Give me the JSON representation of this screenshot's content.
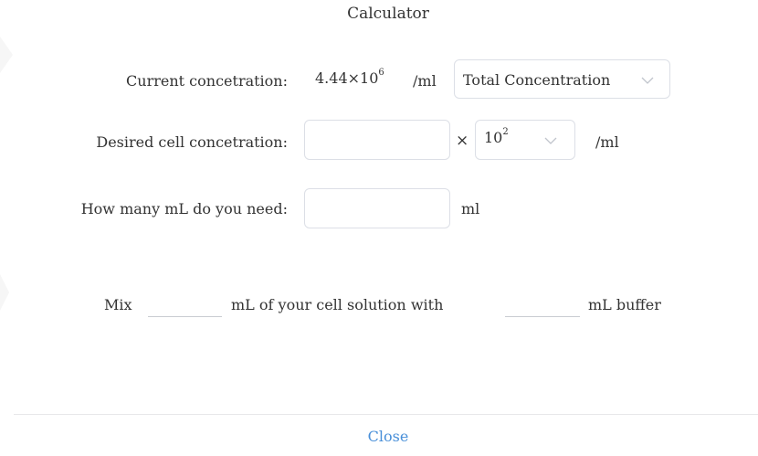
{
  "dialog": {
    "title": "Calculator",
    "close_label": "Close"
  },
  "current": {
    "label": "Current concetration:",
    "value_mantissa": "4.44",
    "value_times": "×10",
    "value_exponent": "6",
    "unit": "/ml",
    "select_value": "Total Concentration"
  },
  "desired": {
    "label": "Desired cell concetration:",
    "input_value": "",
    "multiply_symbol": "×",
    "power_base": "10",
    "power_exponent": "2",
    "unit": "/ml"
  },
  "volume": {
    "label": "How many mL do you need:",
    "input_value": "",
    "unit": "ml"
  },
  "result": {
    "prefix": "Mix",
    "middle": "mL of your cell solution with",
    "suffix": "mL buffer",
    "cell_volume": "",
    "buffer_volume": ""
  },
  "colors": {
    "accent": "#4a90d9",
    "border": "#dcdfe6",
    "text": "#333333"
  }
}
